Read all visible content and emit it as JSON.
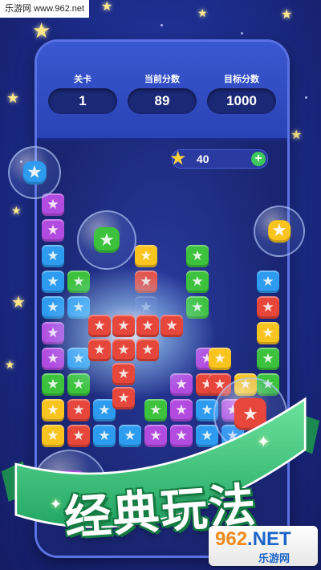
{
  "watermark": {
    "text": "乐游网 www.962.net"
  },
  "hud": {
    "level": {
      "label": "关卡",
      "value": "1"
    },
    "score": {
      "label": "当前分数",
      "value": "89"
    },
    "target": {
      "label": "目标分数",
      "value": "1000"
    }
  },
  "coins": {
    "value": "40",
    "add_icon": "plus-icon",
    "coin_icon": "star-icon"
  },
  "banner": {
    "text": "经典玩法"
  },
  "logo": {
    "main_a": "962",
    "main_b": ".NET",
    "sub": "乐游网"
  },
  "colors": {
    "purple": "#b24ce0",
    "blue": "#2c9bf0",
    "green": "#3cc23c",
    "red": "#e7463b",
    "yellow": "#f9c41d",
    "ribbon": "#39c27a"
  }
}
